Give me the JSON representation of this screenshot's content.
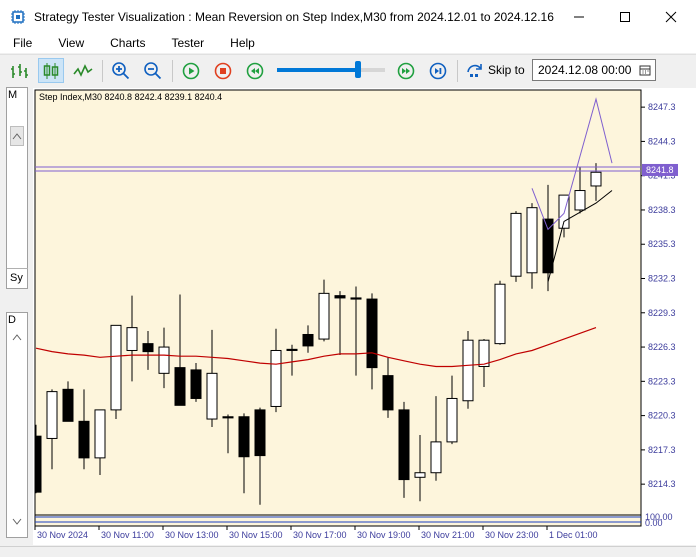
{
  "window": {
    "title": "Strategy Tester Visualization : Mean Reversion on Step Index,M30 from 2024.12.01 to 2024.12.16"
  },
  "menu": [
    "File",
    "View",
    "Charts",
    "Tester",
    "Help"
  ],
  "toolbar": {
    "skip_label": "Skip to",
    "skip_date": "2024.12.08 00:00",
    "speed_level": 0.75
  },
  "left_panel": {
    "top_label": "M",
    "mid_label": "Sy",
    "bottom_label": "D"
  },
  "colors": {
    "chart_bg": "#fdf5dc",
    "axis_text": "#3c3c9c",
    "ma_line": "#c00000",
    "envelope_line": "#7f5fcf",
    "price_line": "#7f5fcf",
    "bull_fill": "#ffffff",
    "bear_fill": "#000000"
  },
  "chart_data": {
    "type": "candlestick",
    "info_label": "Step Index,M30  8240.8 8242.4 8239.1 8240.4",
    "y_ticks": [
      "8247.3",
      "8244.3",
      "8241.3",
      "8238.3",
      "8235.3",
      "8232.3",
      "8229.3",
      "8226.3",
      "8223.3",
      "8220.3",
      "8217.3",
      "8214.3"
    ],
    "ylim": [
      8211.6,
      8248.8
    ],
    "current_price_label": "8241.8",
    "current_price": 8241.8,
    "indicator_ticks": [
      "100.00",
      "0.00"
    ],
    "x_ticks": [
      "30 Nov 2024",
      "30 Nov 11:00",
      "30 Nov 13:00",
      "30 Nov 15:00",
      "30 Nov 17:00",
      "30 Nov 19:00",
      "30 Nov 21:00",
      "30 Nov 23:00",
      "1 Dec 01:00"
    ],
    "candles": [
      {
        "o": 8218.5,
        "h": 8219.5,
        "l": 8213.5,
        "c": 8213.6
      },
      {
        "o": 8218.3,
        "h": 8222.6,
        "l": 8215.6,
        "c": 8222.4
      },
      {
        "o": 8222.6,
        "h": 8223.3,
        "l": 8220.0,
        "c": 8219.8
      },
      {
        "o": 8219.8,
        "h": 8222.6,
        "l": 8215.6,
        "c": 8216.6
      },
      {
        "o": 8216.6,
        "h": 8220.8,
        "l": 8215.1,
        "c": 8220.8
      },
      {
        "o": 8220.8,
        "h": 8228.2,
        "l": 8220.0,
        "c": 8228.2
      },
      {
        "o": 8226.0,
        "h": 8230.8,
        "l": 8223.3,
        "c": 8228.0
      },
      {
        "o": 8226.6,
        "h": 8227.7,
        "l": 8224.3,
        "c": 8225.9
      },
      {
        "o": 8224.0,
        "h": 8228.0,
        "l": 8222.7,
        "c": 8226.3
      },
      {
        "o": 8224.5,
        "h": 8230.9,
        "l": 8221.8,
        "c": 8221.2
      },
      {
        "o": 8224.3,
        "h": 8224.9,
        "l": 8221.5,
        "c": 8221.8
      },
      {
        "o": 8220.0,
        "h": 8227.8,
        "l": 8219.3,
        "c": 8224.0
      },
      {
        "o": 8220.2,
        "h": 8220.4,
        "l": 8217.0,
        "c": 8220.1
      },
      {
        "o": 8220.2,
        "h": 8220.5,
        "l": 8213.5,
        "c": 8216.7
      },
      {
        "o": 8220.8,
        "h": 8221.0,
        "l": 8212.5,
        "c": 8216.8
      },
      {
        "o": 8221.1,
        "h": 8227.9,
        "l": 8220.6,
        "c": 8226.0
      },
      {
        "o": 8226.1,
        "h": 8226.5,
        "l": 8223.8,
        "c": 8226.0
      },
      {
        "o": 8227.4,
        "h": 8228.2,
        "l": 8225.8,
        "c": 8226.4
      },
      {
        "o": 8227.0,
        "h": 8232.2,
        "l": 8226.8,
        "c": 8231.0
      },
      {
        "o": 8230.8,
        "h": 8231.2,
        "l": 8225.6,
        "c": 8230.6
      },
      {
        "o": 8230.6,
        "h": 8231.6,
        "l": 8223.8,
        "c": 8230.5
      },
      {
        "o": 8230.5,
        "h": 8231.0,
        "l": 8222.6,
        "c": 8224.5
      },
      {
        "o": 8223.8,
        "h": 8225.4,
        "l": 8220.1,
        "c": 8220.8
      },
      {
        "o": 8220.8,
        "h": 8221.5,
        "l": 8213.1,
        "c": 8214.7
      },
      {
        "o": 8214.9,
        "h": 8218.6,
        "l": 8212.8,
        "c": 8215.3
      },
      {
        "o": 8215.3,
        "h": 8222.0,
        "l": 8214.6,
        "c": 8218.0
      },
      {
        "o": 8218.0,
        "h": 8223.8,
        "l": 8217.8,
        "c": 8221.8
      },
      {
        "o": 8221.6,
        "h": 8227.7,
        "l": 8220.9,
        "c": 8226.9
      },
      {
        "o": 8224.6,
        "h": 8227.0,
        "l": 8222.8,
        "c": 8226.9
      },
      {
        "o": 8226.6,
        "h": 8232.1,
        "l": 8226.5,
        "c": 8231.8
      },
      {
        "o": 8232.5,
        "h": 8238.2,
        "l": 8232.0,
        "c": 8238.0
      },
      {
        "o": 8232.8,
        "h": 8238.9,
        "l": 8231.4,
        "c": 8238.5
      },
      {
        "o": 8237.5,
        "h": 8240.5,
        "l": 8231.2,
        "c": 8232.8
      },
      {
        "o": 8236.7,
        "h": 8239.5,
        "l": 8235.9,
        "c": 8239.6
      },
      {
        "o": 8238.3,
        "h": 8242.1,
        "l": 8238.0,
        "c": 8240.0
      },
      {
        "o": 8240.4,
        "h": 8242.4,
        "l": 8239.1,
        "c": 8241.6
      }
    ],
    "ma": [
      8226.2,
      8225.9,
      8225.7,
      8225.6,
      8225.4,
      8225.5,
      8225.6,
      8225.6,
      8225.6,
      8225.5,
      8225.5,
      8225.4,
      8225.3,
      8225.1,
      8224.9,
      8224.8,
      8225.0,
      8225.2,
      8225.5,
      8225.7,
      8225.7,
      8225.8,
      8225.4,
      8225.1,
      8224.8,
      8224.6,
      8224.6,
      8224.7,
      8224.8,
      8225.2,
      8225.7,
      8226.0,
      8226.5,
      8227.0,
      8227.5,
      8228.0
    ],
    "upper_band": [
      [
        31,
        8240.2
      ],
      [
        32,
        8236.6
      ],
      [
        33,
        8238.0
      ],
      [
        35,
        8248.0
      ],
      [
        36,
        8242.4
      ]
    ],
    "lower_band": [
      [
        32,
        8232.0
      ],
      [
        33,
        8237.3
      ],
      [
        35,
        8238.9
      ],
      [
        36,
        8240.0
      ]
    ]
  }
}
